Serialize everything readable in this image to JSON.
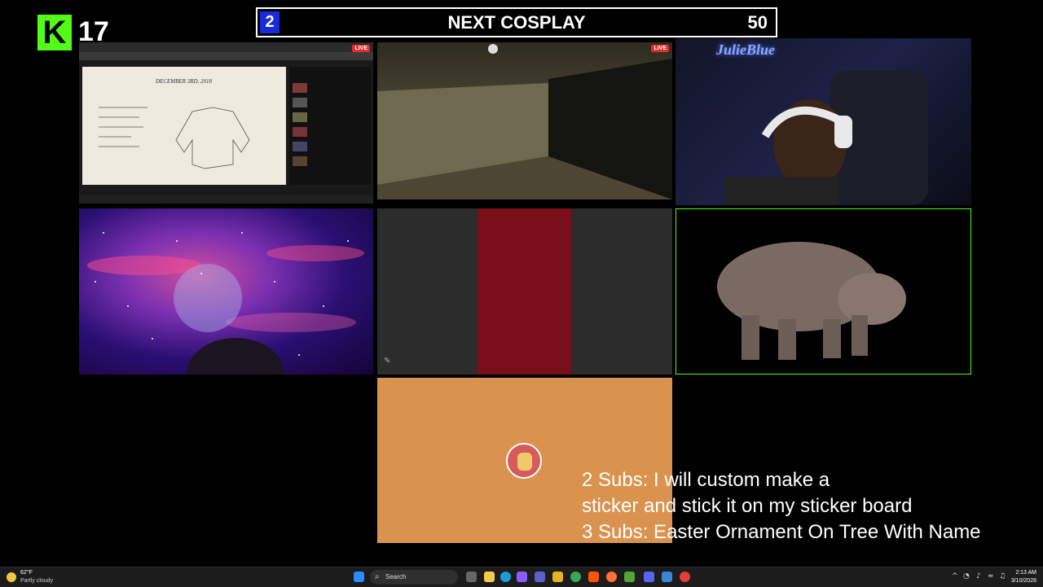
{
  "kick": {
    "count": "17",
    "logo": "K"
  },
  "header": {
    "left_number": "2",
    "title": "NEXT COSPLAY",
    "right_number": "50"
  },
  "tiles": {
    "screen_share": {
      "live": "LIVE",
      "paper_date": "DECEMBER 3RD, 2018"
    },
    "game": {
      "live": "LIVE"
    },
    "webcam_neon": "JulieBlue"
  },
  "subs_text": {
    "line1": "2 Subs: I will custom make a",
    "line2": "sticker and stick it on my sticker board",
    "line3": "3 Subs: Easter Ornament On Tree With Name"
  },
  "taskbar": {
    "weather_temp": "62°F",
    "weather_condition": "Partly cloudy",
    "search_placeholder": "Search",
    "time": "2:13 AM",
    "date": "3/10/2026"
  },
  "colors": {
    "kick_green": "#53fc18",
    "header_blue": "#1a2ad8",
    "avatar_bg": "#d9934f"
  }
}
